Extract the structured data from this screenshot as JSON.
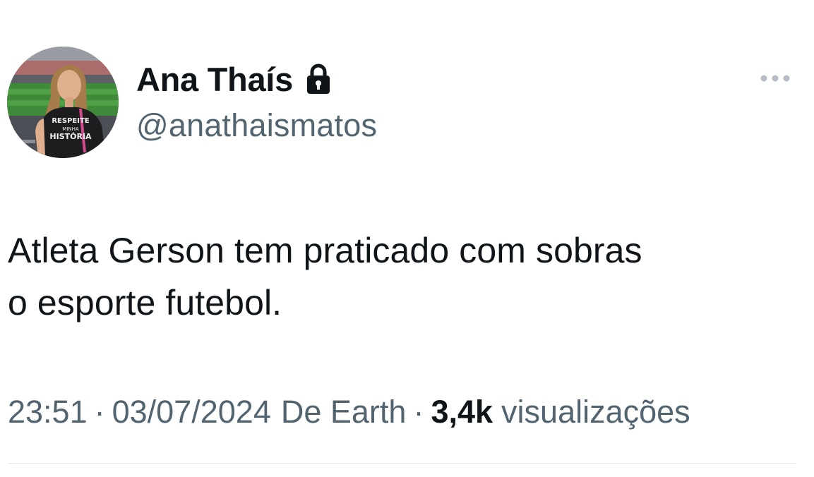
{
  "author": {
    "display_name": "Ana Thaís",
    "handle": "@anathaismatos",
    "protected_icon": "lock-icon",
    "avatar_shirt_text": [
      "RESPEITE",
      "MINHA",
      "HISTÓRIA"
    ]
  },
  "menu": {
    "icon": "more-horizontal-icon"
  },
  "tweet": {
    "text_line_1": "Atleta Gerson tem praticado com sobras",
    "text_line_2": "o esporte futebol."
  },
  "meta": {
    "time": "23:51",
    "separator": "·",
    "date": "03/07/2024",
    "source": "De Earth",
    "views_count": "3,4k",
    "views_label": "visualizações"
  },
  "colors": {
    "text_primary": "#0f1419",
    "text_secondary": "#536471",
    "divider": "#e3e7ea"
  }
}
